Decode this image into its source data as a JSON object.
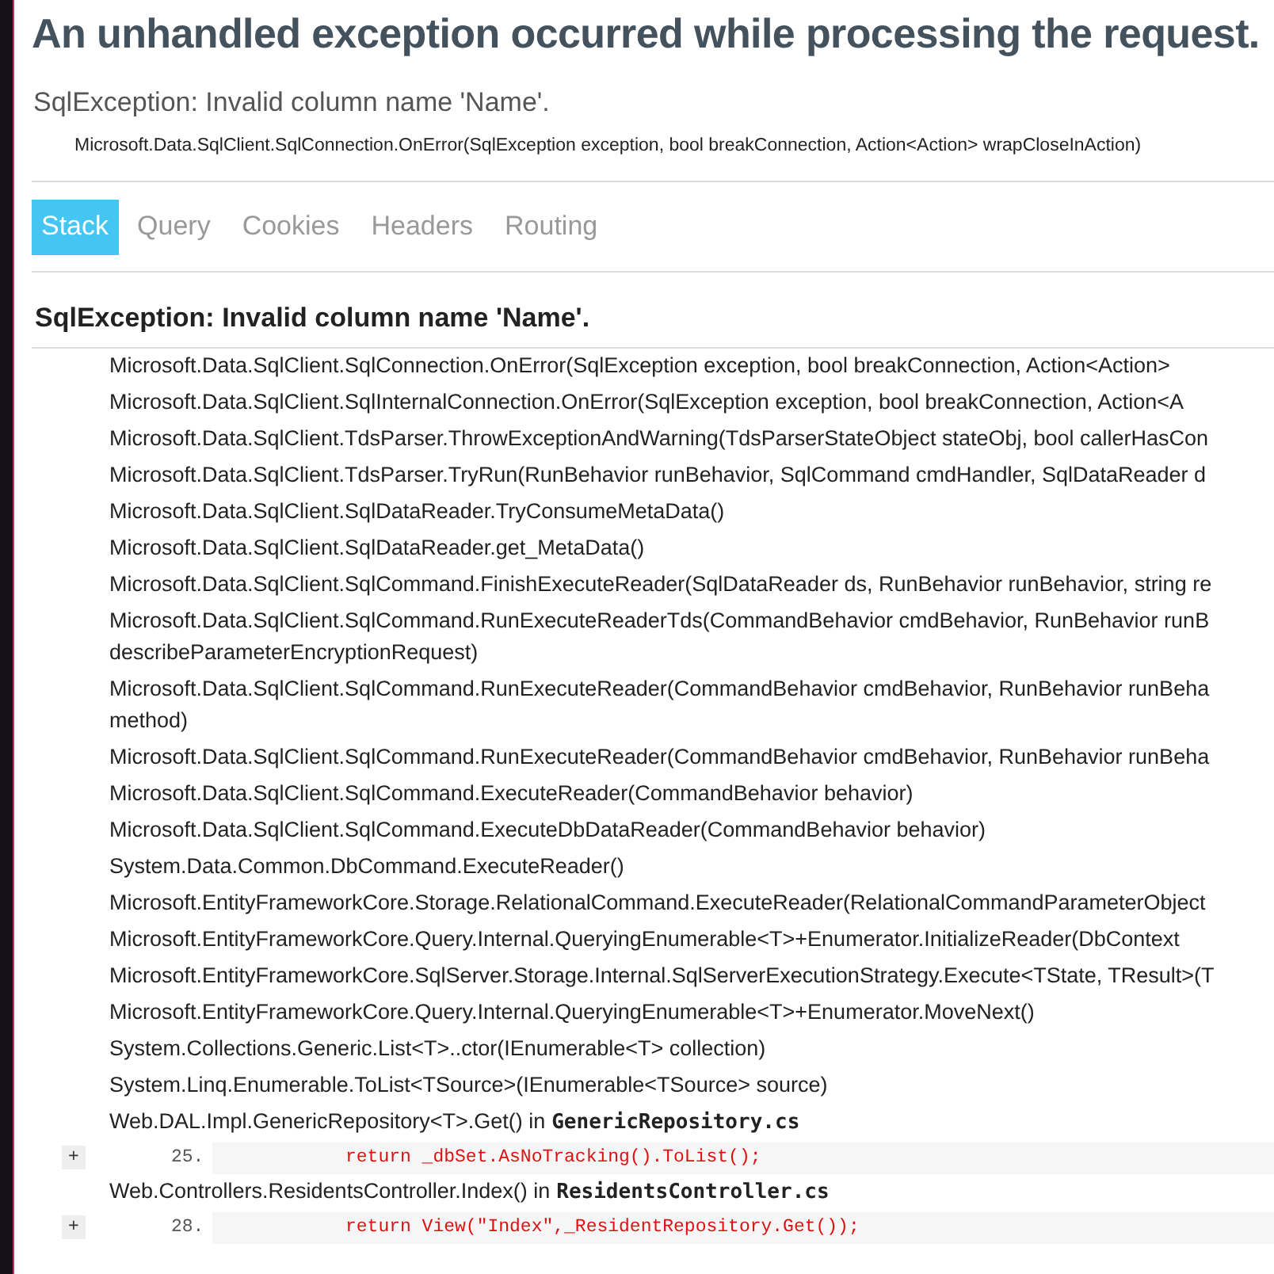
{
  "title": "An unhandled exception occurred while processing the request.",
  "summary": "SqlException: Invalid column name 'Name'.",
  "location": "Microsoft.Data.SqlClient.SqlConnection.OnError(SqlException exception, bool breakConnection, Action<Action> wrapCloseInAction)",
  "tabs": [
    {
      "label": "Stack",
      "selected": true
    },
    {
      "label": "Query",
      "selected": false
    },
    {
      "label": "Cookies",
      "selected": false
    },
    {
      "label": "Headers",
      "selected": false
    },
    {
      "label": "Routing",
      "selected": false
    }
  ],
  "stack": {
    "heading": "SqlException: Invalid column name 'Name'.",
    "frames": [
      {
        "kind": "frame",
        "text": "Microsoft.Data.SqlClient.SqlConnection.OnError(SqlException exception, bool breakConnection, Action<Action>"
      },
      {
        "kind": "frame",
        "text": "Microsoft.Data.SqlClient.SqlInternalConnection.OnError(SqlException exception, bool breakConnection, Action<A"
      },
      {
        "kind": "frame",
        "text": "Microsoft.Data.SqlClient.TdsParser.ThrowExceptionAndWarning(TdsParserStateObject stateObj, bool callerHasCon"
      },
      {
        "kind": "frame",
        "text": "Microsoft.Data.SqlClient.TdsParser.TryRun(RunBehavior runBehavior, SqlCommand cmdHandler, SqlDataReader d"
      },
      {
        "kind": "frame",
        "text": "Microsoft.Data.SqlClient.SqlDataReader.TryConsumeMetaData()"
      },
      {
        "kind": "frame",
        "text": "Microsoft.Data.SqlClient.SqlDataReader.get_MetaData()"
      },
      {
        "kind": "frame",
        "text": "Microsoft.Data.SqlClient.SqlCommand.FinishExecuteReader(SqlDataReader ds, RunBehavior runBehavior, string re"
      },
      {
        "kind": "frame",
        "text": "Microsoft.Data.SqlClient.SqlCommand.RunExecuteReaderTds(CommandBehavior cmdBehavior, RunBehavior runB",
        "continuation": "describeParameterEncryptionRequest)"
      },
      {
        "kind": "frame",
        "text": "Microsoft.Data.SqlClient.SqlCommand.RunExecuteReader(CommandBehavior cmdBehavior, RunBehavior runBeha",
        "continuation": "method)"
      },
      {
        "kind": "frame",
        "text": "Microsoft.Data.SqlClient.SqlCommand.RunExecuteReader(CommandBehavior cmdBehavior, RunBehavior runBeha"
      },
      {
        "kind": "frame",
        "text": "Microsoft.Data.SqlClient.SqlCommand.ExecuteReader(CommandBehavior behavior)"
      },
      {
        "kind": "frame",
        "text": "Microsoft.Data.SqlClient.SqlCommand.ExecuteDbDataReader(CommandBehavior behavior)"
      },
      {
        "kind": "frame",
        "text": "System.Data.Common.DbCommand.ExecuteReader()"
      },
      {
        "kind": "frame",
        "text": "Microsoft.EntityFrameworkCore.Storage.RelationalCommand.ExecuteReader(RelationalCommandParameterObject"
      },
      {
        "kind": "frame",
        "text": "Microsoft.EntityFrameworkCore.Query.Internal.QueryingEnumerable<T>+Enumerator.InitializeReader(DbContext"
      },
      {
        "kind": "frame",
        "text": "Microsoft.EntityFrameworkCore.SqlServer.Storage.Internal.SqlServerExecutionStrategy.Execute<TState, TResult>(T"
      },
      {
        "kind": "frame",
        "text": "Microsoft.EntityFrameworkCore.Query.Internal.QueryingEnumerable<T>+Enumerator.MoveNext()"
      },
      {
        "kind": "frame",
        "text": "System.Collections.Generic.List<T>..ctor(IEnumerable<T> collection)"
      },
      {
        "kind": "frame",
        "text": "System.Linq.Enumerable.ToList<TSource>(IEnumerable<TSource> source)"
      },
      {
        "kind": "source",
        "text": "Web.DAL.Impl.GenericRepository<T>.Get() in",
        "file": "GenericRepository.cs",
        "expander": "+",
        "line_number": "25.",
        "code": "return _dbSet.AsNoTracking().ToList();"
      },
      {
        "kind": "source",
        "text": "Web.Controllers.ResidentsController.Index() in",
        "file": "ResidentsController.cs",
        "expander": "+",
        "line_number": "28.",
        "code": "return View(\"Index\",_ResidentRepository.Get());"
      }
    ]
  }
}
